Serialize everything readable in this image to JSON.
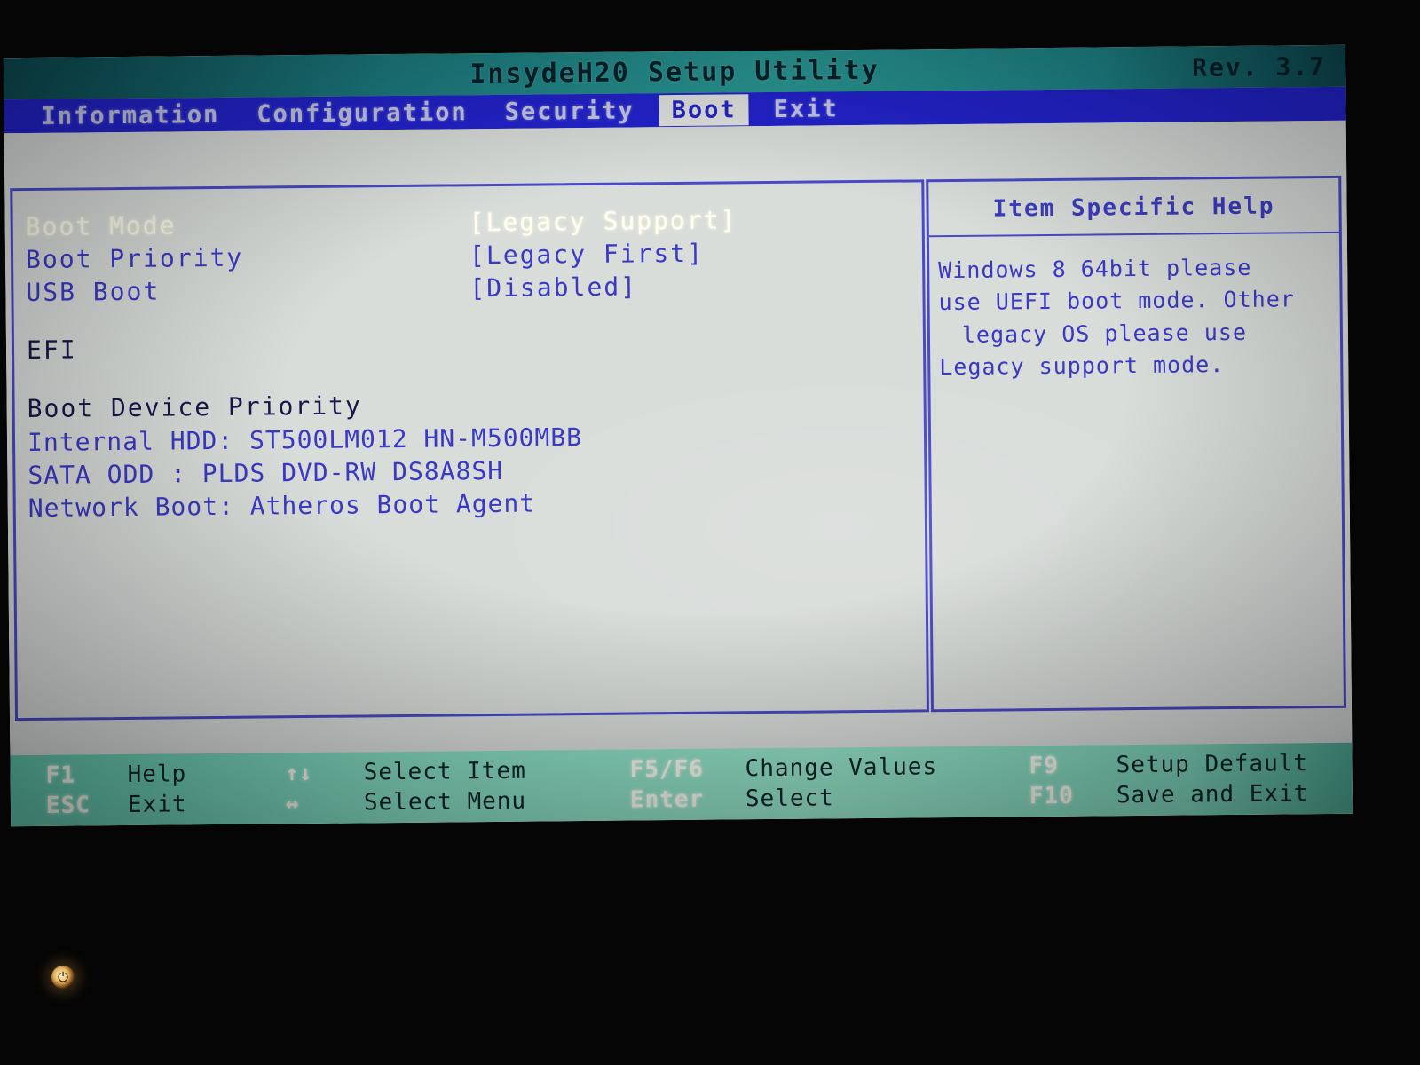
{
  "titlebar": {
    "title": "InsydeH20 Setup Utility",
    "revision": "Rev. 3.7"
  },
  "menu": {
    "items": [
      {
        "label": "Information",
        "selected": false
      },
      {
        "label": "Configuration",
        "selected": false
      },
      {
        "label": "Security",
        "selected": false
      },
      {
        "label": "Boot",
        "selected": true
      },
      {
        "label": "Exit",
        "selected": false
      }
    ]
  },
  "settings": {
    "rows": [
      {
        "label": "Boot Mode",
        "value": "[Legacy Support]",
        "active": true
      },
      {
        "label": "Boot Priority",
        "value": "[Legacy First]",
        "active": false
      },
      {
        "label": "USB Boot",
        "value": "[Disabled]",
        "active": false
      }
    ],
    "efi_label": "EFI",
    "device_priority_heading": "Boot Device Priority",
    "devices": [
      "Internal HDD: ST500LM012 HN-M500MBB",
      "SATA ODD    : PLDS DVD-RW DS8A8SH",
      "Network Boot: Atheros Boot Agent"
    ]
  },
  "help": {
    "title": "Item Specific Help",
    "lines": [
      {
        "text": "Windows 8 64bit please",
        "indent": false
      },
      {
        "text": "use UEFI boot mode. Other",
        "indent": false
      },
      {
        "text": "legacy OS please use",
        "indent": true
      },
      {
        "text": "Legacy support mode.",
        "indent": false
      }
    ]
  },
  "keybar": {
    "row1": [
      {
        "key": "F1",
        "desc": "Help"
      },
      {
        "key": "↑↓",
        "desc": "Select Item"
      },
      {
        "key": "F5/F6",
        "desc": "Change Values"
      },
      {
        "key": "F9",
        "desc": "Setup Default"
      }
    ],
    "row2": [
      {
        "key": "ESC",
        "desc": "Exit"
      },
      {
        "key": "↔",
        "desc": "Select Menu"
      },
      {
        "key": "Enter",
        "desc": "Select"
      },
      {
        "key": "F10",
        "desc": "Save and Exit"
      }
    ]
  },
  "indicator": {
    "power_glyph": "⏻"
  },
  "colors": {
    "title_bar": "#1c7f84",
    "menu_bar": "#2323cf",
    "panel_bg": "#d9ddda",
    "text_blue": "#3b39c4",
    "text_highlight": "#fdfdf4",
    "key_bar": "#86dcc2"
  }
}
